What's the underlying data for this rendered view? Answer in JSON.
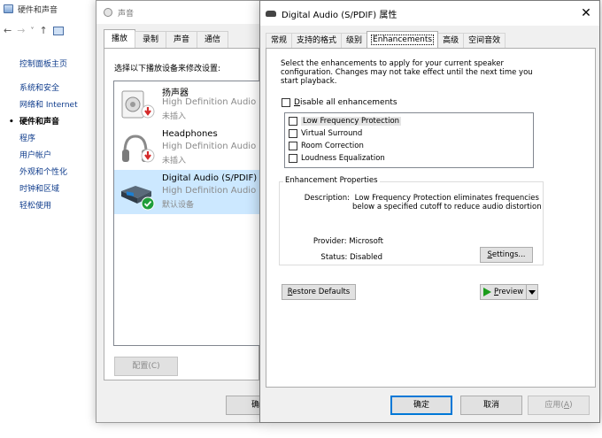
{
  "control_panel": {
    "title": "硬件和声音",
    "home_link": "控制面板主页",
    "links": [
      "系统和安全",
      "网络和 Internet",
      "硬件和声音",
      "程序",
      "用户帐户",
      "外观和个性化",
      "时钟和区域",
      "轻松使用"
    ],
    "current": "硬件和声音"
  },
  "sound_dialog": {
    "title": "声音",
    "tabs": [
      "播放",
      "录制",
      "声音",
      "通信"
    ],
    "selected_tab": "播放",
    "instruction": "选择以下播放设备来修改设置:",
    "devices": [
      {
        "name": "扬声器",
        "driver": "High Definition Audio D",
        "status": "未插入",
        "icon": "speaker-icon",
        "badge": "unplugged-badge-icon"
      },
      {
        "name": "Headphones",
        "driver": "High Definition Audio D",
        "status": "未插入",
        "icon": "headphones-icon",
        "badge": "unplugged-badge-icon"
      },
      {
        "name": "Digital Audio (S/PDIF)",
        "driver": "High Definition Audio D",
        "status": "默认设备",
        "icon": "digital-audio-icon",
        "badge": "default-check-icon"
      }
    ],
    "configure_label": "配置(C)",
    "ok_partial": "确"
  },
  "properties_dialog": {
    "title": "Digital Audio (S/PDIF) 属性",
    "close_glyph": "✕",
    "tabs": [
      "常规",
      "支持的格式",
      "级别",
      "Enhancements",
      "高级",
      "空间音效"
    ],
    "selected_tab": "Enhancements",
    "description": "Select the enhancements to apply for your current speaker configuration. Changes may not take effect until the next time you start playback.",
    "disable_all_u": "D",
    "disable_all_rest": "isable all enhancements",
    "enhancements": [
      "Low Frequency Protection",
      "Virtual Surround",
      "Room Correction",
      "Loudness Equalization"
    ],
    "selected_enhancement": "Low Frequency Protection",
    "properties_legend": "Enhancement Properties",
    "description_label": "Description:",
    "description_line1": "Low Frequency Protection eliminates frequencies",
    "description_line2": "below a specified cutoff to reduce audio distortion",
    "provider_label": "Provider: Microsoft",
    "status_label": "Status: Disabled",
    "settings_u": "S",
    "settings_rest": "ettings...",
    "restore_u": "R",
    "restore_rest": "estore Defaults",
    "preview_u": "P",
    "preview_rest": "review",
    "ok_label": "确定",
    "cancel_label": "取消",
    "apply_label": "应用(",
    "apply_u": "A",
    "apply_end": ")"
  },
  "colors": {
    "link": "#0f3c8c",
    "selection": "#cce8ff",
    "focus": "#0078d7",
    "preview_green": "#1a9c1a",
    "unplugged_red": "#d42a2a",
    "default_green": "#1f9e3a"
  }
}
